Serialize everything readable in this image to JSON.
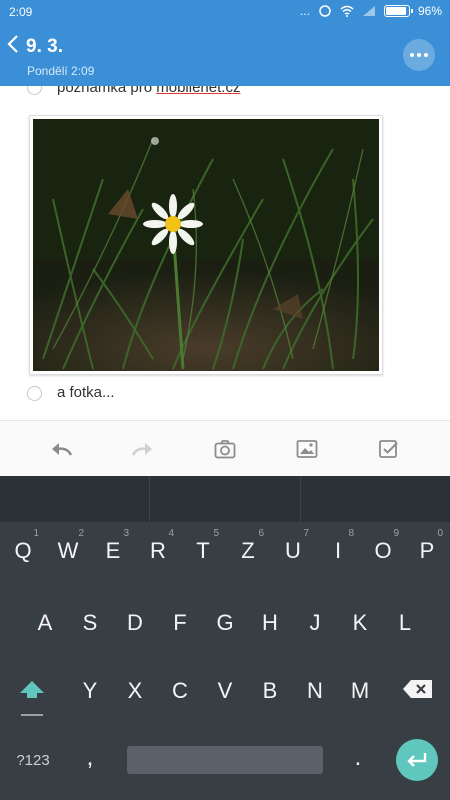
{
  "status_bar": {
    "time": "2:09",
    "signal_dots": "...",
    "battery": "96%"
  },
  "header": {
    "title": "9. 3.",
    "subtitle": "Pondělí 2:09"
  },
  "note": {
    "line1_prefix": "poznámka pro ",
    "line1_link": "mobilenet.cz",
    "line2": "a fotka..."
  },
  "toolbar": {
    "items": [
      "undo-icon",
      "redo-icon",
      "camera-icon",
      "image-icon",
      "checkbox-icon"
    ]
  },
  "keyboard": {
    "row1": [
      {
        "k": "Q",
        "n": "1"
      },
      {
        "k": "W",
        "n": "2"
      },
      {
        "k": "E",
        "n": "3"
      },
      {
        "k": "R",
        "n": "4"
      },
      {
        "k": "T",
        "n": "5"
      },
      {
        "k": "Z",
        "n": "6"
      },
      {
        "k": "U",
        "n": "7"
      },
      {
        "k": "I",
        "n": "8"
      },
      {
        "k": "O",
        "n": "9"
      },
      {
        "k": "P",
        "n": "0"
      }
    ],
    "row2": [
      "A",
      "S",
      "D",
      "F",
      "G",
      "H",
      "J",
      "K",
      "L"
    ],
    "row3": [
      "Y",
      "X",
      "C",
      "V",
      "B",
      "N",
      "M"
    ],
    "symbols_label": "?123",
    "comma": ",",
    "period": "."
  },
  "colors": {
    "header": "#3a8fd6",
    "keyboard": "#373e44",
    "accent": "#5fc7bd"
  }
}
